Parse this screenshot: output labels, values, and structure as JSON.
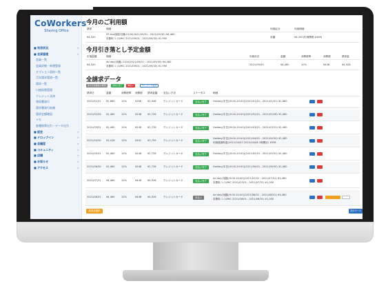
{
  "app": {
    "logo_name": "CoWorkers",
    "logo_sub": "Sharing Office"
  },
  "sidebar": {
    "items": [
      {
        "label": "■ 利用状況",
        "kind": "sec"
      },
      {
        "label": "■ 会員管理",
        "kind": "sec"
      },
      {
        "label": "会員一覧",
        "kind": "sub"
      },
      {
        "label": "会員詳細・新規登録",
        "kind": "sub"
      },
      {
        "label": "オプション契約一覧",
        "kind": "sub"
      },
      {
        "label": "月次請求管理一覧",
        "kind": "sub"
      },
      {
        "label": "請求一覧",
        "kind": "sub"
      },
      {
        "label": "口座振替管理",
        "kind": "sub"
      },
      {
        "label": "クレジット決済",
        "kind": "sub"
      },
      {
        "label": "領収書発行",
        "kind": "sub"
      },
      {
        "label": "請求書発行依頼",
        "kind": "sub"
      },
      {
        "label": "請求金額確認",
        "kind": "sub"
      },
      {
        "label": "メモ",
        "kind": "sub"
      },
      {
        "label": "各種帳票出力・データ出力",
        "kind": "sub"
      },
      {
        "label": "■ 設定",
        "kind": "sec"
      },
      {
        "label": "■ ドロップイン",
        "kind": "sec"
      },
      {
        "label": "■ 会議室",
        "kind": "sec"
      },
      {
        "label": "■ コミュニティ",
        "kind": "sec"
      },
      {
        "label": "■ 店舗",
        "kind": "sec"
      },
      {
        "label": "■ お知らせ",
        "kind": "sec"
      },
      {
        "label": "■ アクセス",
        "kind": "sec"
      }
    ]
  },
  "section1": {
    "title": "今月のご利用額",
    "headers": [
      "請求",
      "明細",
      "",
      "",
      "",
      "",
      "利用区分",
      "利用明細"
    ],
    "row": {
      "amount": "¥4,500",
      "desc1": "FR Hot/固定月額-2100(2021/09/01 - 2021/09/30) ¥4,480",
      "desc2": "手数料 1 (1/MIC 2021/09/01 - 2021/09/30) ¥1,990",
      "kind": "月額",
      "detail": "¥4,500(内消費税 ¥406)"
    }
  },
  "section2": {
    "title": "今月引き落とし予定金額",
    "headers": [
      "引落金額",
      "明細",
      "",
      "",
      "",
      "利用月日",
      "金額",
      "消費税率",
      "消費税",
      "請求金"
    ],
    "row": {
      "amount": "¥4,500",
      "desc1": "Ad day(月額)-2100(2021/09/01 - 2021/09/30) ¥4,480",
      "desc2": "手数料 1 (1/MIC 2021/09/01 - 2021/09/30) ¥1,990",
      "date": "2021/09/30",
      "price": "¥4,480",
      "rate": "10%",
      "tax": "¥448",
      "total": "¥4,928"
    }
  },
  "section3": {
    "title": "全請求データ",
    "filters": [
      "すべての支払い状況",
      "支払い完了",
      "未払い",
      "クレジット決済"
    ],
    "headers": [
      "請求日",
      "金額",
      "消費税率",
      "消費税",
      "請求金額",
      "支払い方法",
      "ステータス",
      "明細"
    ],
    "rows": [
      {
        "date": "2021/01/31",
        "amount": "¥2,680",
        "rate": "10%",
        "tax": "¥268",
        "total": "¥2,948",
        "method": "クレジットカード",
        "status": "支払い完了",
        "desc1": "Holiday(平日)(9:00-20:00)(2021/01/01 - 2021/01/31) ¥2,680",
        "desc2": ""
      },
      {
        "date": "2021/02/28",
        "amount": "¥2,480",
        "rate": "10%",
        "tax": "¥248",
        "total": "¥2,728",
        "method": "クレジットカード",
        "status": "支払い完了",
        "desc1": "Holiday(平日)(9:00-20:00)(2021/02/01 - 2021/02/28) ¥2,480",
        "desc2": ""
      },
      {
        "date": "2021/03/31",
        "amount": "¥2,480",
        "rate": "10%",
        "tax": "¥248",
        "total": "¥2,728",
        "method": "クレジットカード",
        "status": "支払い完了",
        "desc1": "Holiday(平日)(9:00-20:00)(2021/03/01 - 2021/03/31) ¥2,480",
        "desc2": ""
      },
      {
        "date": "2021/04/30",
        "amount": "¥3,418",
        "rate": "10%",
        "tax": "¥341",
        "total": "¥3,759",
        "method": "クレジットカード",
        "status": "支払い完了",
        "desc1": "Holiday(平日)(9:00-20:00)(2021/04/01 - 2021/04/30) ¥2,480",
        "desc2": "利用超過料金(2021/04/07-2021/04/08 2時間分) ¥938"
      },
      {
        "date": "2021/05/31",
        "amount": "¥2,480",
        "rate": "10%",
        "tax": "¥248",
        "total": "¥2,728",
        "method": "クレジットカード",
        "status": "支払い完了",
        "desc1": "Holiday(平日)(9:00-20:00)(2021/05/01 - 2021/05/31) ¥2,480",
        "desc2": ""
      },
      {
        "date": "2021/06/30",
        "amount": "¥2,480",
        "rate": "10%",
        "tax": "¥248",
        "total": "¥2,728",
        "method": "クレジットカード",
        "status": "支払い完了",
        "desc1": "Holiday(平日)(9:00-20:00)(2021/06/01 - 2021/06/30) ¥2,480",
        "desc2": ""
      },
      {
        "date": "2021/07/31",
        "amount": "¥4,480",
        "rate": "10%",
        "tax": "¥448",
        "total": "¥4,928",
        "method": "クレジットカード",
        "status": "支払い完了",
        "desc1": "Ad day(月額)(9:00-20:00)(2021/07/01 - 2021/07/31) ¥3,480",
        "desc2": "手数料 1 (1/MIC 2021/07/01 - 2021/07/31) ¥1,000"
      },
      {
        "date": "2021/08/31",
        "amount": "¥4,480",
        "rate": "10%",
        "tax": "¥448",
        "total": "¥4,928",
        "method": "クレジットカード",
        "status": "未払い",
        "desc1": "Ad day(月額)(9:00-20:00)(2021/08/01 - 2021/08/31) ¥3,480",
        "desc2": "手数料 1 (1/MIC 2021/08/01 - 2021/08/31) ¥1,000"
      }
    ],
    "download_label": "請求書発行",
    "footer_left": "請求月選択",
    "footer_right": "次のページ"
  }
}
